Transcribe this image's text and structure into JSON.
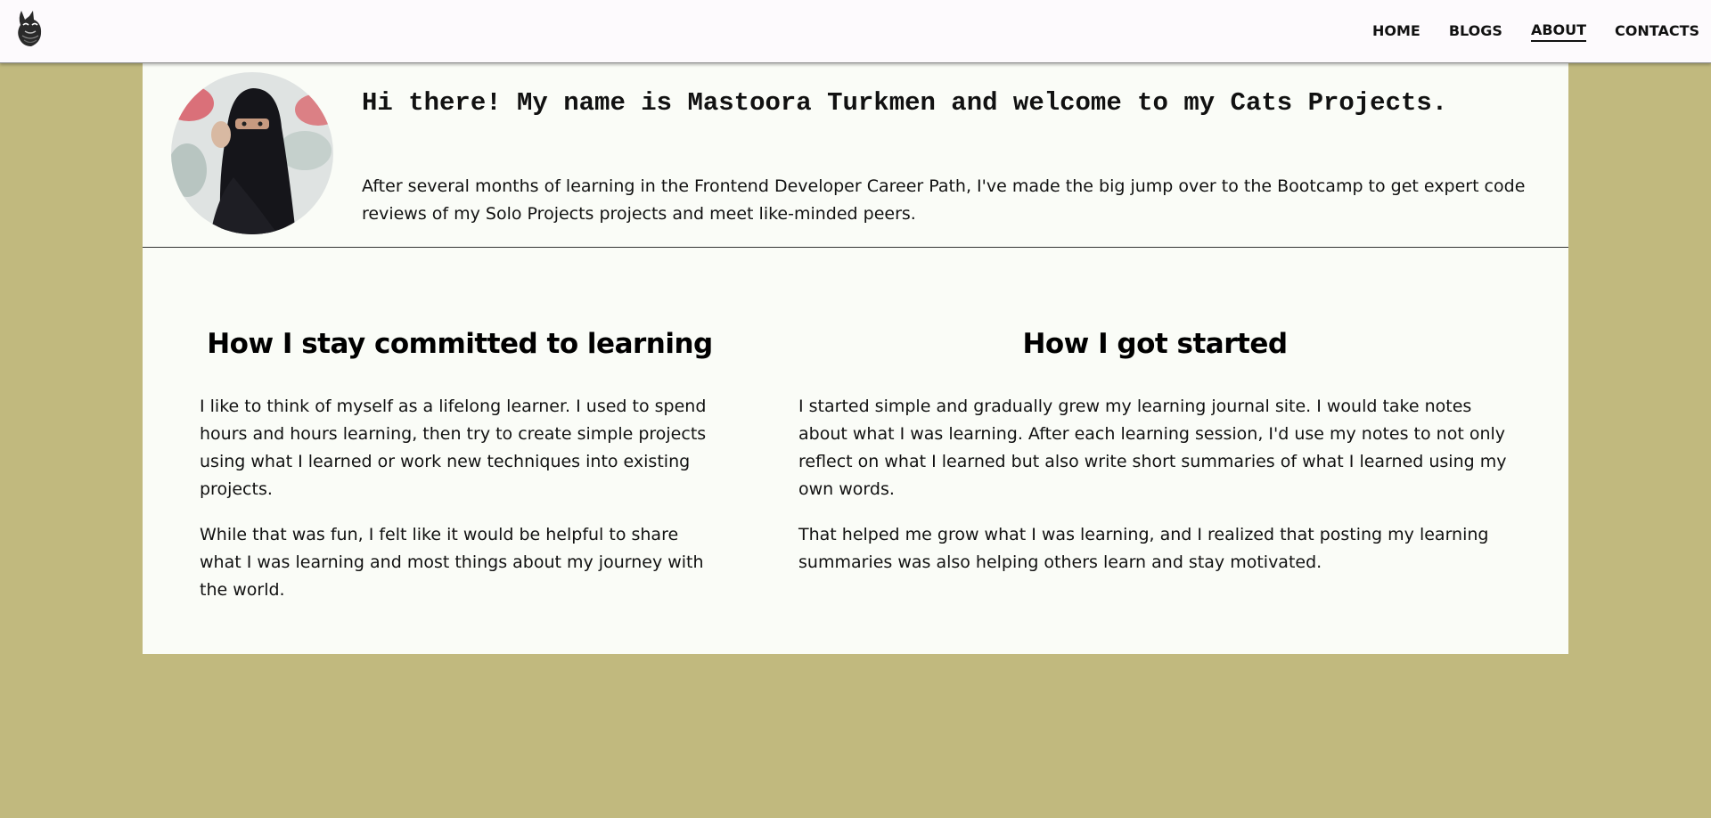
{
  "nav": {
    "logo": "cat-logo-icon",
    "links": [
      "HOME",
      "BLOGS",
      "ABOUT",
      "CONTACTS"
    ],
    "active": "ABOUT"
  },
  "intro": {
    "title": "Hi there! My name is Mastoora Turkmen and welcome to my Cats Projects.",
    "text": "After several months of learning in the Frontend Developer Career Path, I've made the big jump over to the Bootcamp to get expert code reviews of my Solo Projects projects and meet like-minded peers."
  },
  "sections": [
    {
      "heading": "How I stay committed to learning",
      "paragraphs": [
        "I like to think of myself as a lifelong learner. I used to spend hours and hours learning, then try to create simple projects using what I learned or work new techniques into existing projects.",
        "While that was fun, I felt like it would be helpful to share what I was learning and most things about my journey with the world."
      ]
    },
    {
      "heading": "How I got started",
      "paragraphs": [
        "I started simple and gradually grew my learning journal site. I would take notes about what I was learning. After each learning session, I'd use my notes to not only reflect on what I learned but also write short summaries of what I learned using my own words.",
        "That helped me grow what I was learning, and I realized that posting my learning summaries was also helping others learn and stay motivated."
      ]
    }
  ],
  "colors": {
    "page_background": "#c1b97e",
    "card_background": "#fafcf7",
    "navbar_background": "#fdfafd"
  }
}
